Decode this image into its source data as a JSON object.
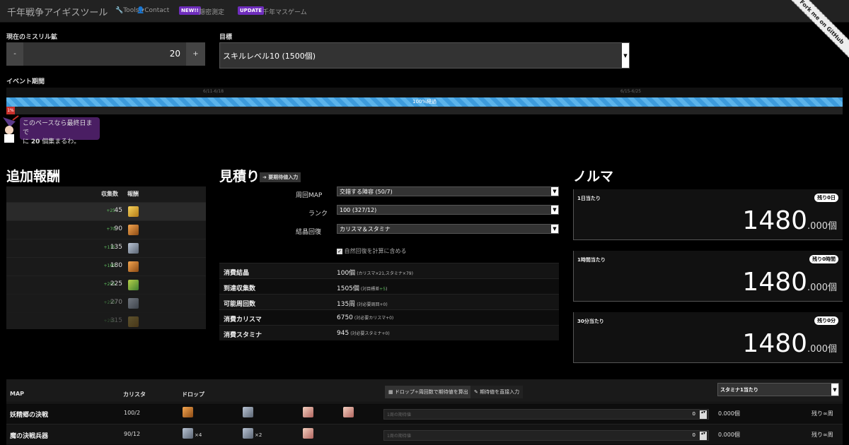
{
  "nav": {
    "brand": "千年戦争アイギスツール",
    "tools": "Tools ▾",
    "contact": "Contact",
    "new_badge": "NEW!!",
    "new_link": "隠密測定",
    "update_badge": "UPDATE",
    "update_link": "千年マスゲーム",
    "ribbon": "Fork me on GitHub"
  },
  "counter": {
    "label": "現在のミスリル鉱",
    "minus": "-",
    "plus": "+",
    "value": "20"
  },
  "target": {
    "label": "目標",
    "selected": "スキルレベル10 (1500個)"
  },
  "event": {
    "label": "イベント期間",
    "start": "6/11-6/18",
    "end": "6/15-6/25",
    "progress_text": "100%経過",
    "progress_fraction": 1.0,
    "collect_percent": "1%",
    "bubble_line1": "このペースなら最終日まで",
    "bubble_pre": "に",
    "bubble_num": "20",
    "bubble_post": "個集まるわ。"
  },
  "rewards": {
    "title": "追加報酬",
    "col_count": "収集数",
    "col_reward": "報酬",
    "rows": [
      {
        "plus": "+25",
        "count": "45",
        "icon": "gold"
      },
      {
        "plus": "+70",
        "count": "90",
        "icon": "orange"
      },
      {
        "plus": "+115",
        "count": "135",
        "icon": "grey"
      },
      {
        "plus": "+160",
        "count": "180",
        "icon": "orange"
      },
      {
        "plus": "+205",
        "count": "225",
        "icon": "green"
      },
      {
        "plus": "+250",
        "count": "270",
        "icon": "grey"
      },
      {
        "plus": "+295",
        "count": "315",
        "icon": "gold"
      }
    ]
  },
  "estimate": {
    "title": "見積り",
    "expected_btn": "➜ 要期待値入力",
    "map_label": "周回MAP",
    "map_value": "交錯する陣容 (50/7)",
    "rank_label": "ランク",
    "rank_value": "100 (327/12)",
    "recovery_label": "結晶回復",
    "recovery_value": "カリスマ＆スタミナ",
    "natural_label": "自然回復を計算に含める",
    "results": [
      {
        "key": "消費結晶",
        "value": "100個",
        "note_pre": "(カリスマ×21,スタミナ×79)",
        "note_green": ""
      },
      {
        "key": "到達収集数",
        "value": "1505個",
        "note_pre": "(対目標差",
        "note_green": "+5",
        "note_post": ")"
      },
      {
        "key": "可能周回数",
        "value": "135周",
        "note_pre": "(対必要周回+0)",
        "note_green": ""
      },
      {
        "key": "消費カリスマ",
        "value": "6750",
        "note_pre": "(対必要カリスマ+0)",
        "note_green": ""
      },
      {
        "key": "消費スタミナ",
        "value": "945",
        "note_pre": "(対必要スタミナ+0)",
        "note_green": ""
      }
    ]
  },
  "quota": {
    "title": "ノルマ",
    "boxes": [
      {
        "label": "1日当たり",
        "pill": "残り0日",
        "int": "1480",
        "dec": ".000個"
      },
      {
        "label": "1時間当たり",
        "pill": "残り0時間",
        "int": "1480",
        "dec": ".000個"
      },
      {
        "label": "30分当たり",
        "pill": "残り0分",
        "int": "1480",
        "dec": ".000個"
      }
    ]
  },
  "maptable": {
    "col_map": "MAP",
    "col_charisma": "カリスタ",
    "col_drop": "ドロップ",
    "calc_btn": "ドロップ÷周回数で期待値を算出",
    "direct_btn": "期待値を直接入力",
    "stamina_select": "スタミナ1当たり",
    "rows": [
      {
        "name": "妖精郷の決戦",
        "cost": "100/2",
        "mult1": "",
        "mult2": "",
        "placeholder": "1周の期待値",
        "num": "0",
        "amount": "0.000個",
        "remain": "残り∞周"
      },
      {
        "name": "魔の決戦兵器",
        "cost": "90/12",
        "mult1": "×4",
        "mult2": "×2",
        "placeholder": "1周の期待値",
        "num": "0",
        "amount": "0.000個",
        "remain": "残り∞周"
      }
    ]
  }
}
